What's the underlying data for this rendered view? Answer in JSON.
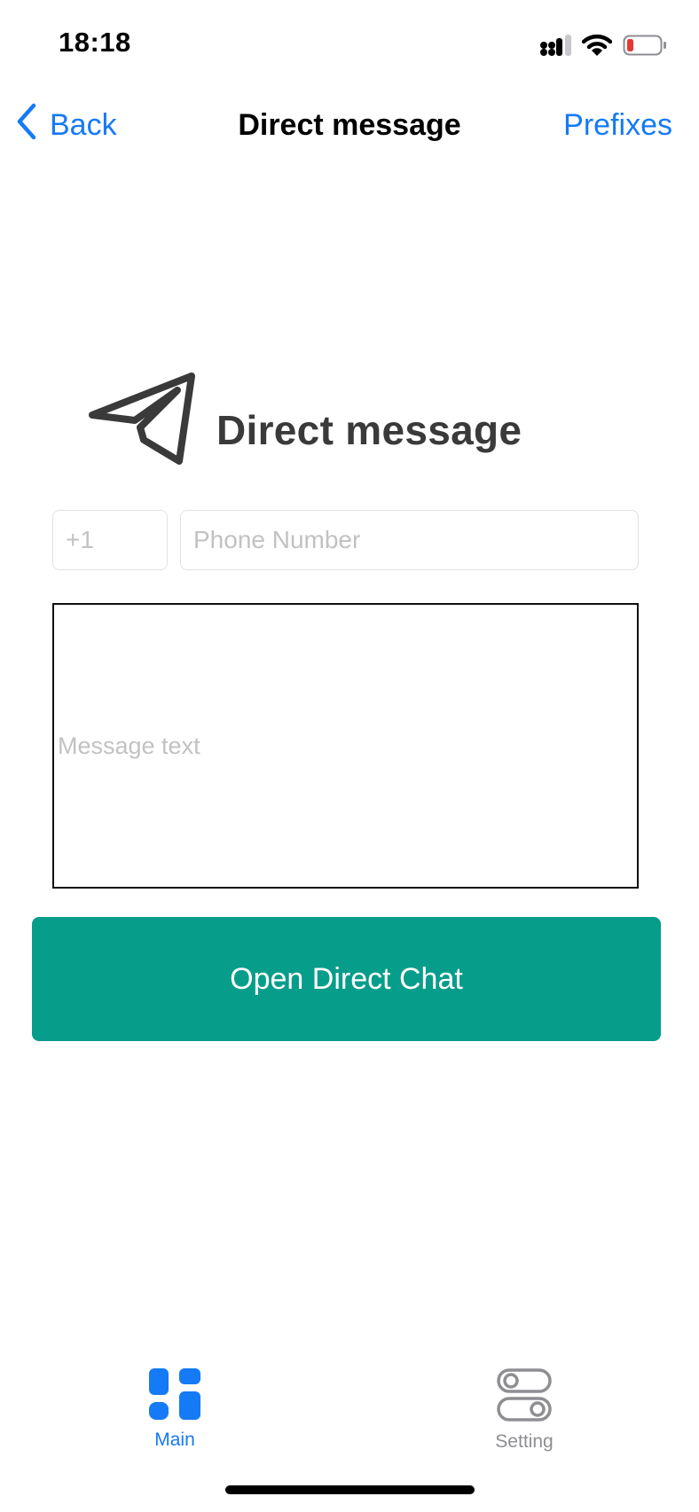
{
  "status_bar": {
    "time": "18:18",
    "icons": [
      "cellular-signal-icon",
      "wifi-icon",
      "battery-low-icon"
    ]
  },
  "nav": {
    "back_label": "Back",
    "title": "Direct message",
    "right_label": "Prefixes"
  },
  "hero": {
    "icon": "paper-plane-icon",
    "title": "Direct message"
  },
  "form": {
    "prefix_placeholder": "+1",
    "phone_placeholder": "Phone Number",
    "message_placeholder": "Message text",
    "submit_label": "Open Direct Chat"
  },
  "tab_bar": {
    "tabs": [
      {
        "label": "Main",
        "icon": "grid-icon",
        "active": true
      },
      {
        "label": "Setting",
        "icon": "toggles-icon",
        "active": false
      }
    ]
  },
  "colors": {
    "accent": "#157AF6",
    "button": "#079D8B",
    "battery_low": "#E53935"
  }
}
